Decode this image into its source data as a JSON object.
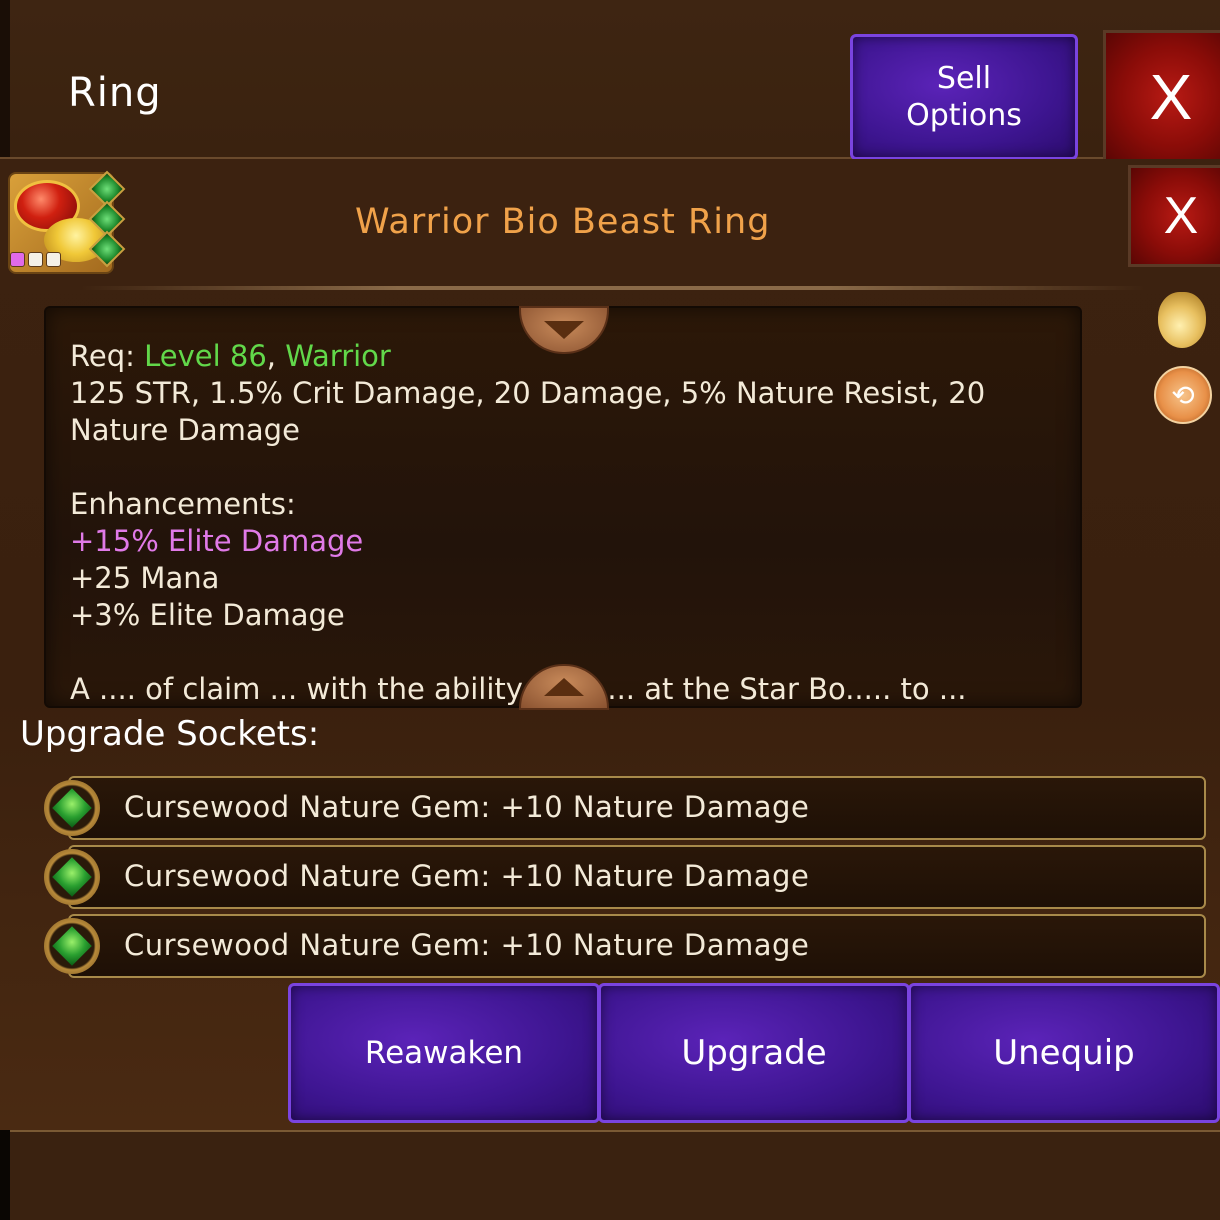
{
  "header": {
    "title": "Ring",
    "sell_options_label": "Sell\nOptions",
    "close_label": "X"
  },
  "item": {
    "name": "Warrior Bio Beast Ring",
    "close_label": "X",
    "rarity_colors": [
      "#e06ae8",
      "#f4f0e6",
      "#f4f0e6"
    ],
    "description": {
      "req_prefix": "Req: ",
      "req_level": "Level 86",
      "req_sep": ", ",
      "req_class": "Warrior",
      "stats": "125 STR, 1.5% Crit Damage, 20 Damage, 5% Nature Resist, 20 Nature Damage",
      "enhancements_title": "Enhancements:",
      "enhancement_1": "+15% Elite Damage",
      "enhancement_2": "+25 Mana",
      "enhancement_3": "+3% Elite Damage",
      "lore_partial": "A .... of claim ... with the ability ... to ... at the Star Bo..... to ..."
    }
  },
  "side_icons": [
    "money-bag-icon",
    "swap-icon"
  ],
  "sockets": {
    "title": "Upgrade Sockets:",
    "items": [
      {
        "label": "Cursewood Nature Gem: +10 Nature Damage"
      },
      {
        "label": "Cursewood Nature Gem: +10 Nature Damage"
      },
      {
        "label": "Cursewood Nature Gem: +10 Nature Damage"
      }
    ]
  },
  "actions": {
    "reawaken": "Reawaken",
    "upgrade": "Upgrade",
    "unequip": "Unequip"
  },
  "colors": {
    "item_name": "#f0a24a",
    "requirement": "#62d84a",
    "rare_enhancement": "#e07ae8",
    "button_purple": "#3d1590",
    "button_red": "#8a0c08"
  }
}
